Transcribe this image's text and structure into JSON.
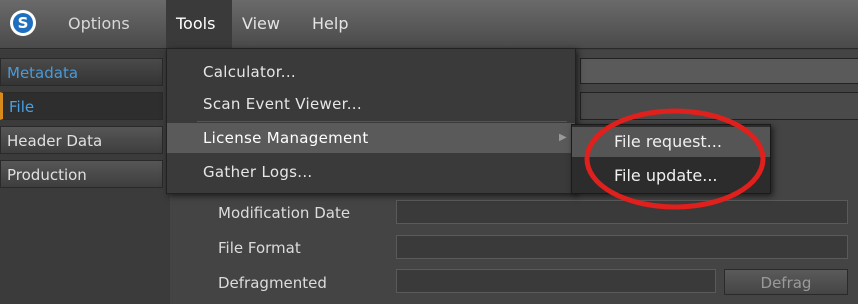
{
  "menubar": {
    "logo_letter": "S",
    "items": [
      "Options",
      "Tools",
      "View",
      "Help"
    ]
  },
  "sidebar": {
    "items": [
      "Metadata",
      "File",
      "Header Data",
      "Production"
    ]
  },
  "form": {
    "modification_date_label": "Modification Date",
    "file_format_label": "File Format",
    "defragmented_label": "Defragmented",
    "defrag_button": "Defrag"
  },
  "tools_menu": {
    "items": [
      "Calculator...",
      "Scan Event Viewer...",
      "License Management",
      "Gather Logs..."
    ]
  },
  "license_submenu": {
    "items": [
      "File request...",
      "File update..."
    ]
  },
  "colors": {
    "annotation": "#e0201c",
    "active_sidebar": "#4aa0e0",
    "selected_indicator": "#d88a1a"
  }
}
